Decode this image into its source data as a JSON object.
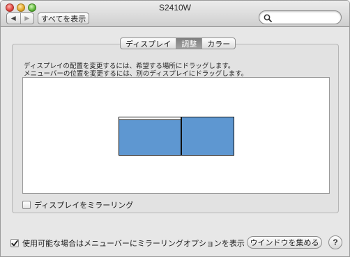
{
  "window": {
    "title": "S2410W"
  },
  "toolbar": {
    "back_icon": "◀",
    "forward_icon": "▶",
    "show_all_label": "すべてを表示",
    "search_placeholder": ""
  },
  "tabs": [
    {
      "label": "ディスプレイ",
      "active": false
    },
    {
      "label": "調整",
      "active": true
    },
    {
      "label": "カラー",
      "active": false
    }
  ],
  "arrangement": {
    "instruction_line1": "ディスプレイの配置を変更するには、希望する場所にドラッグします。",
    "instruction_line2": "メニューバーの位置を変更するには、別のディスプレイにドラッグします。",
    "displays": [
      {
        "name": "main-display",
        "has_menubar": true
      },
      {
        "name": "secondary-display",
        "has_menubar": false
      }
    ]
  },
  "mirroring": {
    "label": "ディスプレイをミラーリング",
    "checked": false
  },
  "footer": {
    "show_menubar_option_label": "使用可能な場合はメニューバーにミラーリングオプションを表示",
    "show_menubar_option_checked": true,
    "gather_windows_label": "ウインドウを集める",
    "help_label": "?"
  },
  "colors": {
    "display_blue": "#5e97d1",
    "selected_tab": "#8a8a8a"
  }
}
